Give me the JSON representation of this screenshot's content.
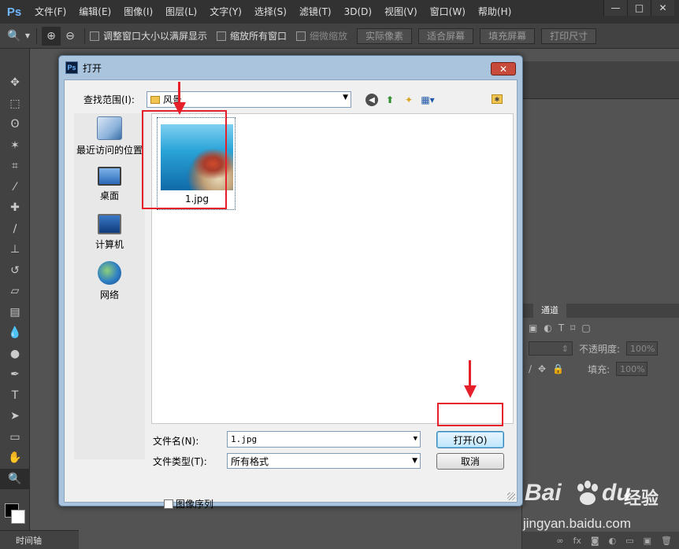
{
  "app": {
    "logo": "Ps",
    "menu": [
      "文件(F)",
      "编辑(E)",
      "图像(I)",
      "图层(L)",
      "文字(Y)",
      "选择(S)",
      "滤镜(T)",
      "3D(D)",
      "视图(V)",
      "窗口(W)",
      "帮助(H)"
    ],
    "window_controls": {
      "minimize": "—",
      "restore": "□",
      "close": "✕"
    }
  },
  "options_bar": {
    "resize_windows_label": "调整窗口大小以满屏显示",
    "zoom_all_label": "缩放所有窗口",
    "scrubby_zoom_label": "细微缩放",
    "actual_pixels": "实际像素",
    "fit_screen": "适合屏幕",
    "fill_screen": "填充屏幕",
    "print_size": "打印尺寸"
  },
  "panels": {
    "channels_tab": "通道",
    "opacity_label": "不透明度:",
    "opacity_value": "100%",
    "fill_label": "填充:",
    "fill_value": "100%",
    "timeline_tab": "时间轴"
  },
  "dialog": {
    "title": "打开",
    "look_in_label": "查找范围(I):",
    "look_in_value": "风景",
    "places": [
      "最近访问的位置",
      "桌面",
      "计算机",
      "网络"
    ],
    "files": [
      {
        "name": "1.jpg"
      }
    ],
    "file_name_label": "文件名(N):",
    "file_name_value": "1.jpg",
    "file_type_label": "文件类型(T):",
    "file_type_value": "所有格式",
    "open_button": "打开(O)",
    "cancel_button": "取消",
    "image_sequence_label": "图像序列"
  },
  "watermark": {
    "brand_left": "Bai",
    "brand_right": "du",
    "brand_cn": "经验",
    "url": "jingyan.baidu.com"
  },
  "colors": {
    "annotation_red": "#e5202a",
    "ps_dark": "#323232",
    "dialog_frame": "#a9c4dc"
  }
}
